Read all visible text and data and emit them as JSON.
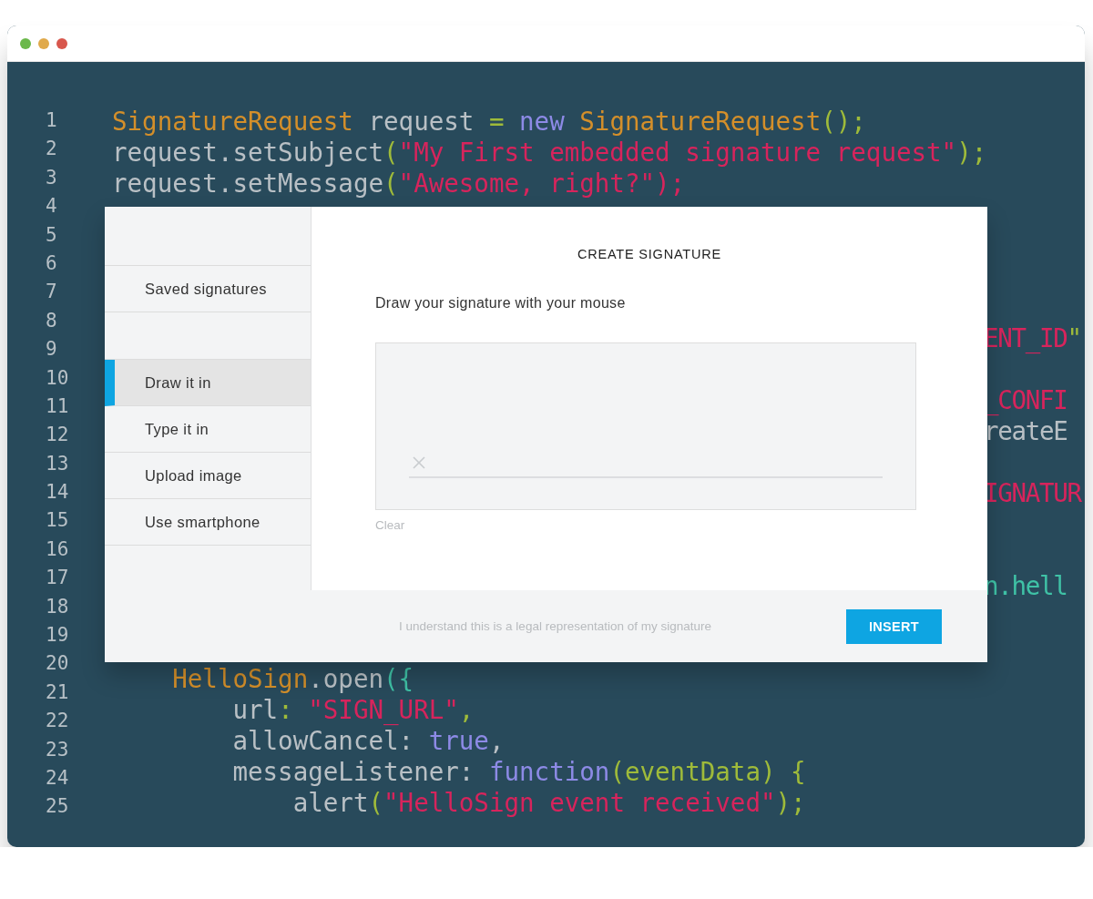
{
  "code": {
    "numbers": [
      "1",
      "2",
      "3",
      "4",
      "5",
      "6",
      "7",
      "8",
      "9",
      "10",
      "11",
      "12",
      "13",
      "14",
      "15",
      "16",
      "17",
      "18",
      "19",
      "20",
      "21",
      "22",
      "23",
      "24",
      "25"
    ],
    "lines": [
      {
        "kind": "full",
        "tokens": [
          {
            "kind": "type",
            "text": "SignatureRequest"
          },
          {
            "kind": "plain",
            "text": " request "
          },
          {
            "kind": "punct",
            "text": "= "
          },
          {
            "kind": "keyword",
            "text": "new "
          },
          {
            "kind": "type",
            "text": "SignatureRequest"
          },
          {
            "kind": "punct",
            "text": "();"
          }
        ]
      },
      {
        "kind": "full",
        "tokens": [
          {
            "kind": "plain",
            "text": "request.setSubject"
          },
          {
            "kind": "punct",
            "text": "("
          },
          {
            "kind": "string",
            "text": "\"My First embedded signature request\""
          },
          {
            "kind": "punct",
            "text": ");"
          }
        ]
      },
      {
        "kind": "full",
        "tokens": [
          {
            "kind": "plain",
            "text": "request.setMessage"
          },
          {
            "kind": "punct",
            "text": "("
          },
          {
            "kind": "string",
            "text": "\"Awesome, right?\""
          },
          {
            "kind": "string",
            "text": ");"
          }
        ]
      },
      {
        "kind": "blank"
      },
      {
        "kind": "blank"
      },
      {
        "kind": "blank"
      },
      {
        "kind": "blank"
      },
      {
        "kind": "fragment",
        "tokens": [
          {
            "kind": "string",
            "text": "ENT_ID"
          },
          {
            "kind": "punct",
            "text": "\""
          }
        ]
      },
      {
        "kind": "blank"
      },
      {
        "kind": "fragment",
        "tokens": [
          {
            "kind": "string",
            "text": "_CONFI"
          }
        ]
      },
      {
        "kind": "fragment",
        "tokens": [
          {
            "kind": "plain",
            "text": "reateE"
          }
        ]
      },
      {
        "kind": "blank"
      },
      {
        "kind": "fragment",
        "tokens": [
          {
            "kind": "string",
            "text": "IGNATUR"
          }
        ]
      },
      {
        "kind": "blank"
      },
      {
        "kind": "blank"
      },
      {
        "kind": "fragment",
        "tokens": [
          {
            "kind": "accent",
            "text": "n.hell"
          }
        ]
      },
      {
        "kind": "blank"
      },
      {
        "kind": "blank"
      },
      {
        "kind": "full",
        "tokens": [
          {
            "kind": "type",
            "text": "    HelloSign"
          },
          {
            "kind": "plain",
            "text": ".open"
          },
          {
            "kind": "accent",
            "text": "({"
          }
        ]
      },
      {
        "kind": "full",
        "tokens": [
          {
            "kind": "plain",
            "text": "        url"
          },
          {
            "kind": "punct",
            "text": ": "
          },
          {
            "kind": "string",
            "text": "\"SIGN_URL\""
          },
          {
            "kind": "punct",
            "text": ","
          }
        ]
      },
      {
        "kind": "full",
        "tokens": [
          {
            "kind": "plain",
            "text": "        allowCancel: "
          },
          {
            "kind": "keyword",
            "text": "true"
          },
          {
            "kind": "plain",
            "text": ","
          }
        ]
      },
      {
        "kind": "full",
        "tokens": [
          {
            "kind": "plain",
            "text": "        messageListener: "
          },
          {
            "kind": "keyword",
            "text": "function"
          },
          {
            "kind": "punct",
            "text": "(eventData) {"
          }
        ]
      },
      {
        "kind": "full",
        "tokens": [
          {
            "kind": "plain",
            "text": "            alert"
          },
          {
            "kind": "punct",
            "text": "("
          },
          {
            "kind": "string",
            "text": "\"HelloSign event received\""
          },
          {
            "kind": "punct",
            "text": ");"
          }
        ]
      }
    ]
  },
  "dialog": {
    "title": "CREATE SIGNATURE",
    "sidebar": {
      "groups": [
        {
          "items": [
            {
              "label": "Saved signatures",
              "selected": false
            }
          ]
        },
        {
          "items": [
            {
              "label": "Draw it in",
              "selected": true
            },
            {
              "label": "Type it in",
              "selected": false
            },
            {
              "label": "Upload image",
              "selected": false
            },
            {
              "label": "Use smartphone",
              "selected": false
            }
          ]
        }
      ]
    },
    "instruction": "Draw your signature with your mouse",
    "clear": "Clear",
    "agreement": "I understand this is a legal representation of my signature",
    "insert": "INSERT"
  }
}
